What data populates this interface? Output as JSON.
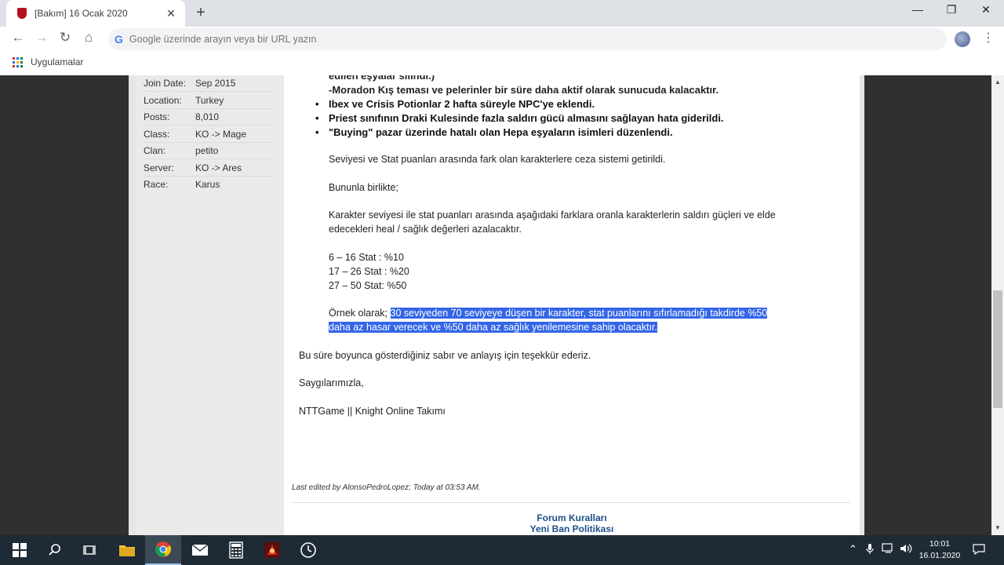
{
  "browser": {
    "tab_title": "[Bakım] 16 Ocak 2020",
    "tab_close": "✕",
    "new_tab": "+",
    "omnibox_placeholder": "Google üzerinde arayın veya bir URL yazın",
    "bookmarks_apps_label": "Uygulamalar",
    "window_controls": {
      "minimize": "—",
      "restore": "❐",
      "close": "✕"
    }
  },
  "user_info": [
    {
      "key": "Join Date:",
      "value": "Sep 2015"
    },
    {
      "key": "Location:",
      "value": "Turkey"
    },
    {
      "key": "Posts:",
      "value": "8,010"
    },
    {
      "key": "Class:",
      "value": "KO -> Mage"
    },
    {
      "key": "Clan:",
      "value": "petito"
    },
    {
      "key": "Server:",
      "value": "KO -> Ares"
    },
    {
      "key": "Race:",
      "value": "Karus"
    }
  ],
  "post": {
    "cut_top_line": "edilen eşyalar silindi.)",
    "moradon_line": "-Moradon Kış teması ve pelerinler bir süre daha aktif olarak sunucuda kalacaktır.",
    "bullets": [
      "Ibex ve Crisis Potionlar 2 hafta süreyle NPC'ye eklendi.",
      "Priest sınıfının Draki Kulesinde fazla saldırı gücü almasını sağlayan hata giderildi.",
      "\"Buying\" pazar üzerinde hatalı olan Hepa eşyaların isimleri düzenlendi."
    ],
    "para1": "Seviyesi ve Stat puanları arasında fark olan karakterlere ceza sistemi getirildi.",
    "para2": "Bununla birlikte;",
    "para3_line1": "Karakter seviyesi ile stat puanları arasında aşağıdaki farklara oranla karakterlerin saldırı güçleri ve elde",
    "para3_line2": "edecekleri heal / sağlık değerleri azalacaktır.",
    "stat1": "6 – 16 Stat : %10",
    "stat2": "17 – 26 Stat : %20",
    "stat3": "27 – 50 Stat: %50",
    "example_prefix": "Örnek olarak; ",
    "example_hl_line1": "30 seviyeden 70 seviyeye düşen bir karakter, stat puanlarını sıfırlamadığı takdirde %50",
    "example_hl_line2": "daha az hasar verecek ve %50 daha az sağlık yenilemesine sahip olacaktır.",
    "thanks": "Bu süre boyunca gösterdiğiniz sabır ve anlayış için teşekkür ederiz.",
    "regards": "Saygılarımızla,",
    "signature": "NTTGame || Knight Online Takımı",
    "last_edited": "Last edited by AlonsoPedroLopez; Today at 03:53 AM.",
    "footer_link1": "Forum Kuralları",
    "footer_link2": "Yeni Ban Politikası"
  },
  "taskbar": {
    "time": "10:01",
    "date": "16.01.2020"
  },
  "colors": {
    "selection": "#3366e6",
    "link": "#1d4f8a",
    "taskbar": "#1e2a35"
  }
}
